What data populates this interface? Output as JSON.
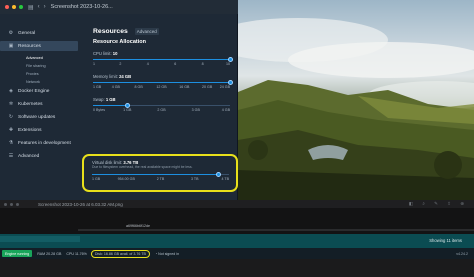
{
  "window": {
    "title": "Screenshot 2023-10-26..."
  },
  "sidebar": {
    "items": [
      {
        "label": "General",
        "icon": "gear-icon"
      },
      {
        "label": "Resources",
        "icon": "resources-icon",
        "active": true
      },
      {
        "label": "Docker Engine",
        "icon": "engine-icon"
      },
      {
        "label": "Kubernetes",
        "icon": "kubernetes-icon"
      },
      {
        "label": "Software updates",
        "icon": "update-icon"
      },
      {
        "label": "Extensions",
        "icon": "puzzle-icon"
      },
      {
        "label": "Features in development",
        "icon": "beaker-icon"
      },
      {
        "label": "Advanced",
        "icon": "advanced-icon"
      }
    ],
    "subitems": [
      "Advanced",
      "File sharing",
      "Proxies",
      "Network"
    ]
  },
  "content": {
    "tab_resources": "Resources",
    "tab_advanced": "Advanced",
    "section_title": "Resource Allocation",
    "cpu": {
      "label": "CPU limit:",
      "value": "10",
      "level": 1.0,
      "ticks": [
        "1",
        "2",
        "4",
        "6",
        "8",
        "10"
      ]
    },
    "memory": {
      "label": "Memory limit:",
      "value": "24 GB",
      "level": 1.0,
      "ticks": [
        "1 GB",
        "4 GB",
        "8 GB",
        "12 GB",
        "16 GB",
        "20 GB",
        "24 GB"
      ]
    },
    "swap": {
      "label": "Swap:",
      "value": "1 GB",
      "level": 0.25,
      "ticks": [
        "0 Bytes",
        "1 GB",
        "2 GB",
        "3 GB",
        "4 GB"
      ]
    },
    "disk": {
      "label": "Virtual disk limit:",
      "value": "3.76 TB",
      "level": 0.92,
      "note": "Due to filesystem overhead, the real available space might be less.",
      "ticks": [
        "1 GB",
        "954.00 GB",
        "2 TB",
        "3 TB",
        "4 TB"
      ]
    }
  },
  "lower": {
    "title": "Screenshot 2023-10-26 at 6.03.32 AM.png",
    "row_text": "a69f66b6f12de",
    "count": "Showing 11 items"
  },
  "statusbar": {
    "engine": "Engine running",
    "ram": "RAM 20.28 GB",
    "cpu": "CPU 11.76%",
    "disk": "Disk: 16.86 GB avail. of 3.76 TB",
    "signed": "Not signed in",
    "version": "v4.24.2"
  },
  "colors": {
    "accent": "#1d8fe0",
    "highlight": "#e8e01b",
    "engine_running": "#18a55b"
  }
}
